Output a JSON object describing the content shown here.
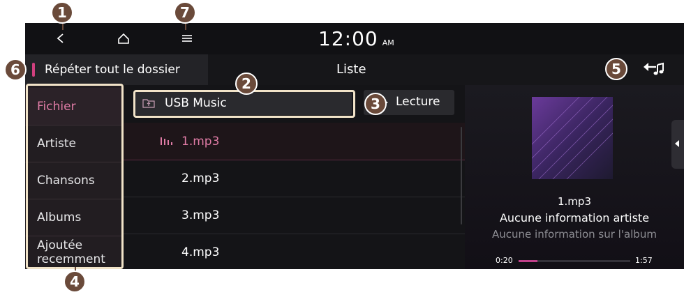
{
  "statusbar": {
    "back_icon": "chevron-left-icon",
    "home_icon": "home-icon",
    "menu_icon": "hamburger-menu-icon",
    "time": "12:00",
    "ampm": "AM"
  },
  "titlebar": {
    "repeat_label": "Répéter tout le dossier",
    "title": "Liste",
    "back_to_playing_icon": "back-to-now-playing-icon"
  },
  "menu": {
    "items": [
      {
        "label": "Fichier",
        "active": true
      },
      {
        "label": "Artiste"
      },
      {
        "label": "Chansons"
      },
      {
        "label": "Albums"
      },
      {
        "label": "Ajoutée recemment"
      }
    ]
  },
  "folder": {
    "label": "USB Music",
    "icon": "folder-up-icon"
  },
  "play_button": {
    "label": "Lecture",
    "icon": "play-icon"
  },
  "files": [
    {
      "name": "1.mp3",
      "playing": true
    },
    {
      "name": "2.mp3"
    },
    {
      "name": "3.mp3"
    },
    {
      "name": "4.mp3"
    }
  ],
  "now_playing": {
    "title": "1.mp3",
    "artist": "Aucune information artiste",
    "album": "Aucune information sur l'album",
    "elapsed": "0:20",
    "total": "1:57",
    "progress": 0.17
  },
  "callouts": [
    "1",
    "2",
    "3",
    "4",
    "5",
    "6",
    "7"
  ],
  "colors": {
    "accent": "#d1407f",
    "callout": "#6a4a3a",
    "highlight_box": "#f1e3c8"
  }
}
